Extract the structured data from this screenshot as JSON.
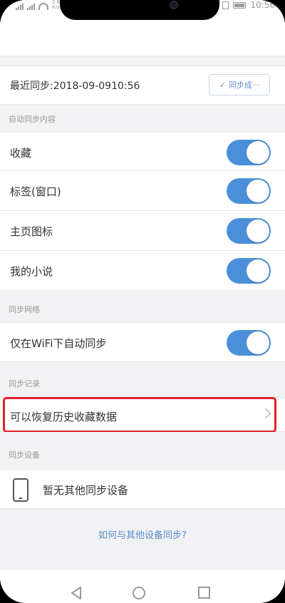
{
  "status_bar": {
    "network_speed": "2.6\nK/s",
    "time": "10:56"
  },
  "last_sync": {
    "label": "最近同步:2018-09-0910:56",
    "button_label": "同步成···"
  },
  "sections": {
    "auto_sync_content": "自动同步内容",
    "sync_network": "同步网络",
    "sync_records": "同步记录",
    "sync_devices": "同步设备"
  },
  "auto_sync_items": [
    {
      "label": "收藏",
      "on": true
    },
    {
      "label": "标签(窗口)",
      "on": true
    },
    {
      "label": "主页图标",
      "on": true
    },
    {
      "label": "我的小说",
      "on": true
    }
  ],
  "wifi_only": {
    "label": "仅在WiFi下自动同步",
    "on": true
  },
  "restore": {
    "label": "可以恢复历史收藏数据"
  },
  "devices": {
    "empty_label": "暂无其他同步设备"
  },
  "help_link": "如何与其他设备同步?",
  "colors": {
    "accent": "#4a90d9",
    "highlight": "#e0202c",
    "link": "#5a8cc8"
  }
}
